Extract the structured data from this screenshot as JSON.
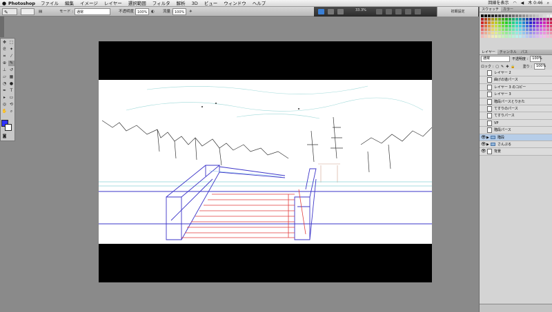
{
  "menubar": {
    "apple": "",
    "app": "Photoshop",
    "items": [
      "ファイル",
      "編集",
      "イメージ",
      "レイヤー",
      "選択範囲",
      "フィルタ",
      "解析",
      "3D",
      "ビュー",
      "ウィンドウ",
      "ヘルプ"
    ],
    "status": "回線を表示",
    "clock": "木 0:46"
  },
  "options": {
    "mode_label": "モード :",
    "mode_value": "通常",
    "opacity_label": "不透明度 :",
    "opacity_value": "100%",
    "flow_label": "流量 :",
    "flow_value": "100%"
  },
  "appbar": {
    "zoom": "33.3%",
    "workspace": "初期設定"
  },
  "panels": {
    "top_tabs": [
      "スウォッチ",
      "カラー"
    ],
    "layer_tabs": [
      "レイヤー",
      "チャンネル",
      "パス"
    ],
    "blend_mode": "通常",
    "opacity_label": "不透明度 :",
    "opacity_value": "100%",
    "lock_label": "ロック :",
    "fill_label": "塗り :",
    "fill_value": "100%",
    "layers": [
      {
        "name": "レイヤー 2",
        "visible": false,
        "type": "layer"
      },
      {
        "name": "曲げの道パース",
        "visible": false,
        "type": "layer"
      },
      {
        "name": "レイヤー 3 のコピー",
        "visible": false,
        "type": "layer"
      },
      {
        "name": "レイヤー 3",
        "visible": false,
        "type": "layer"
      },
      {
        "name": "階段パースとりかた",
        "visible": false,
        "type": "layer"
      },
      {
        "name": "てすりのパース",
        "visible": false,
        "type": "layer"
      },
      {
        "name": "てすりパース",
        "visible": false,
        "type": "layer"
      },
      {
        "name": "VP",
        "visible": false,
        "type": "layer"
      },
      {
        "name": "階段パース",
        "visible": false,
        "type": "layer"
      },
      {
        "name": "階段",
        "visible": true,
        "type": "group",
        "selected": true
      },
      {
        "name": "さんぷる",
        "visible": true,
        "type": "group"
      },
      {
        "name": "背景",
        "visible": true,
        "type": "layer"
      }
    ]
  },
  "colors": {
    "foreground": "#2f32ff",
    "background": "#ffffff"
  }
}
